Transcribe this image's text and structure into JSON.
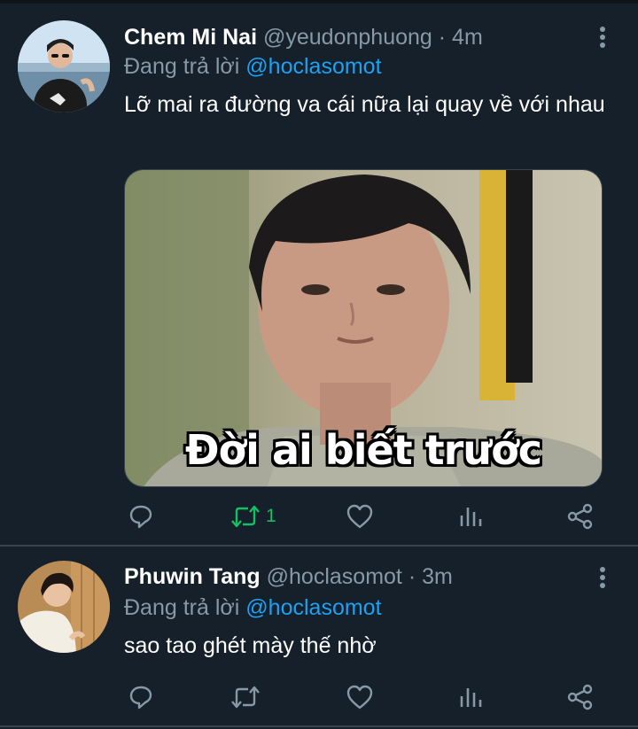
{
  "tweets": [
    {
      "display_name": "Chem Mi Nai",
      "handle": "@yeudonphuong",
      "separator": "·",
      "time": "4m",
      "reply_prefix": "Đang trả lời",
      "reply_to": "@hoclasomot",
      "text": "Lỡ mai ra đường va cái nữa lại quay về với nhau",
      "media_caption": "Đời ai biết trước",
      "retweet_count": "1",
      "retweeted": true
    },
    {
      "display_name": "Phuwin Tang",
      "handle": "@hoclasomot",
      "separator": "·",
      "time": "3m",
      "reply_prefix": "Đang trả lời",
      "reply_to": "@hoclasomot",
      "text": "sao tao ghét mày thế nhờ",
      "retweet_count": "",
      "retweeted": false
    }
  ],
  "icons": {
    "reply": "reply-icon",
    "retweet": "retweet-icon",
    "like": "heart-icon",
    "analytics": "analytics-icon",
    "share": "share-icon",
    "more": "more-vertical-icon"
  },
  "colors": {
    "background": "#15202b",
    "secondary_text": "#8899a6",
    "link": "#1da1f2",
    "retweet_active": "#17bf63",
    "divider": "#38444d"
  }
}
